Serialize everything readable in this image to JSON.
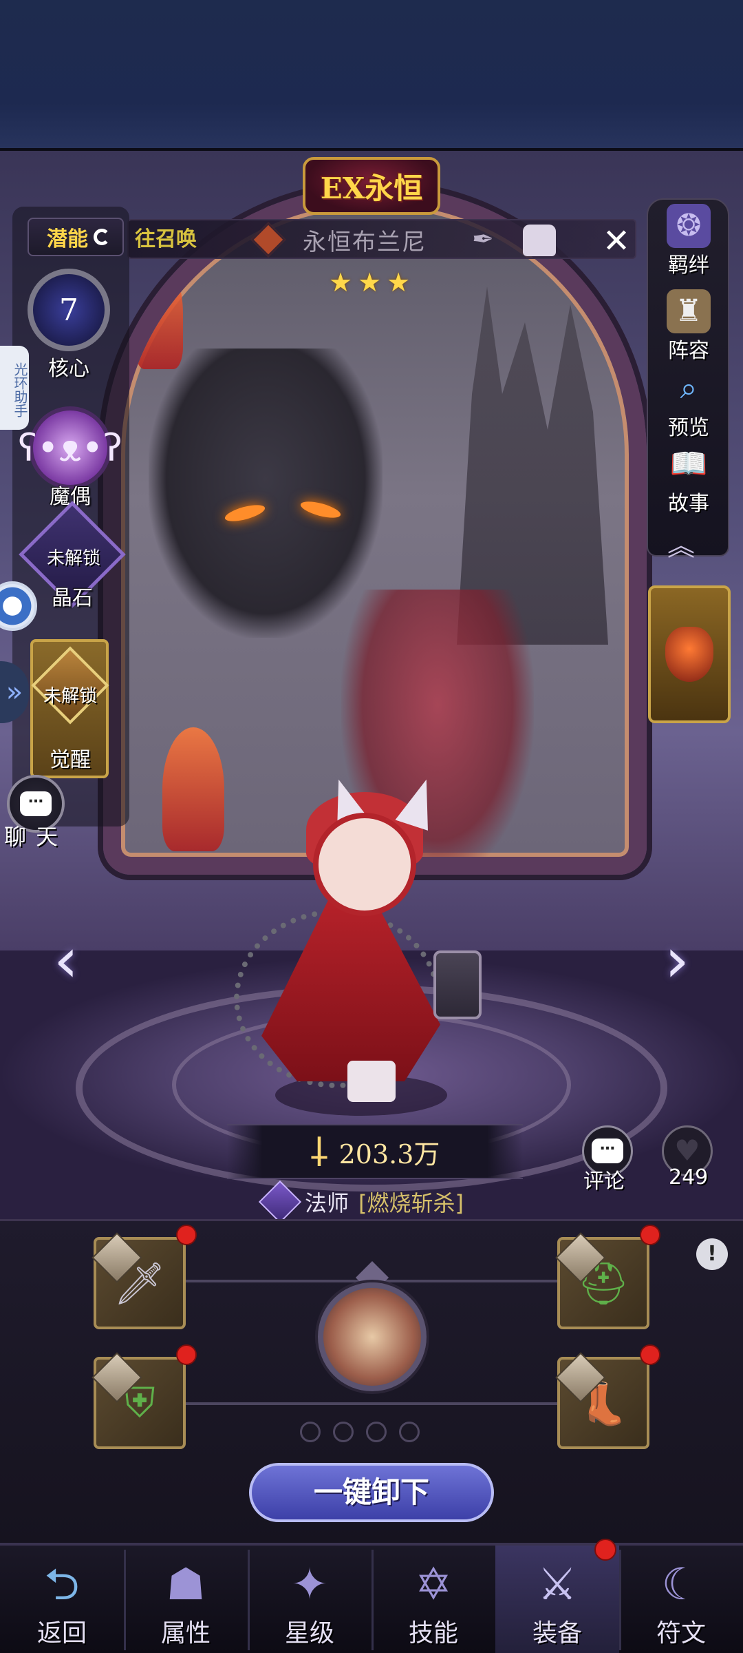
{
  "hero": {
    "rarity_badge": "EX永恒",
    "name": "永恒布兰尼",
    "recall_link": "往召唤",
    "stars": 3,
    "power": "203.3万",
    "class": "法师",
    "skill": "[燃烧斩杀]",
    "likes": "249"
  },
  "left_menu": {
    "potential": "潜能",
    "core_level": "7",
    "core": "核心",
    "puppet": "魔偶",
    "crystal_lock": "未解锁",
    "crystal": "晶石",
    "awaken_lock": "未解锁",
    "awaken": "觉醒",
    "chat": "聊 天"
  },
  "overlay": {
    "helper": "光环助手"
  },
  "right_menu": [
    {
      "label": "羁绊",
      "icon": "book-icon"
    },
    {
      "label": "阵容",
      "icon": "chess-icon"
    },
    {
      "label": "预览",
      "icon": "magnifier-icon"
    },
    {
      "label": "故事",
      "icon": "open-book-icon"
    }
  ],
  "actions": {
    "comment": "评论",
    "unequip_all": "一键卸下"
  },
  "equipment": [
    {
      "slot": "weapon",
      "icon": "sword-icon",
      "alert": true
    },
    {
      "slot": "helmet",
      "icon": "helmet-icon",
      "alert": true
    },
    {
      "slot": "armor",
      "icon": "armor-icon",
      "alert": true
    },
    {
      "slot": "boots",
      "icon": "boots-icon",
      "alert": true
    }
  ],
  "bottom_nav": [
    {
      "label": "返回",
      "icon": "back-icon",
      "active": false,
      "alert": false
    },
    {
      "label": "属性",
      "icon": "hooded-figure-icon",
      "active": false,
      "alert": false
    },
    {
      "label": "星级",
      "icon": "star-emblem-icon",
      "active": false,
      "alert": false
    },
    {
      "label": "技能",
      "icon": "spellbook-icon",
      "active": false,
      "alert": false
    },
    {
      "label": "装备",
      "icon": "crossed-swords-icon",
      "active": true,
      "alert": true
    },
    {
      "label": "符文",
      "icon": "rune-icon",
      "active": false,
      "alert": false
    }
  ],
  "colors": {
    "accent_gold": "#ffd64a",
    "alert_red": "#e0221e",
    "button_blue": "#5a5fc8"
  }
}
